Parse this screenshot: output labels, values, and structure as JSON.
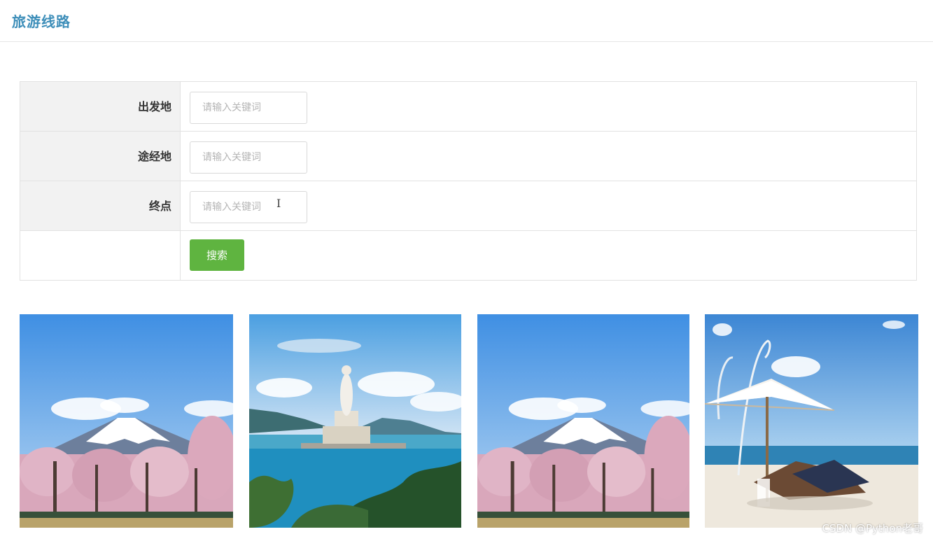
{
  "header": {
    "title": "旅游线路"
  },
  "form": {
    "rows": [
      {
        "label": "出发地",
        "placeholder": "请输入关键词",
        "value": ""
      },
      {
        "label": "途经地",
        "placeholder": "请输入关键词",
        "value": ""
      },
      {
        "label": "终点",
        "placeholder": "请输入关键词",
        "value": ""
      }
    ],
    "search_label": "搜索",
    "button_color": "#5fb440"
  },
  "cards": [
    {
      "image": "mount-fuji-cherry-blossom-photo",
      "caption": ""
    },
    {
      "image": "guanyin-statue-sea-photo",
      "caption": ""
    },
    {
      "image": "mount-fuji-cherry-blossom-photo",
      "caption": ""
    },
    {
      "image": "beach-umbrella-loungers-photo",
      "caption": ""
    }
  ],
  "watermark": "CSDN @Python老哥"
}
